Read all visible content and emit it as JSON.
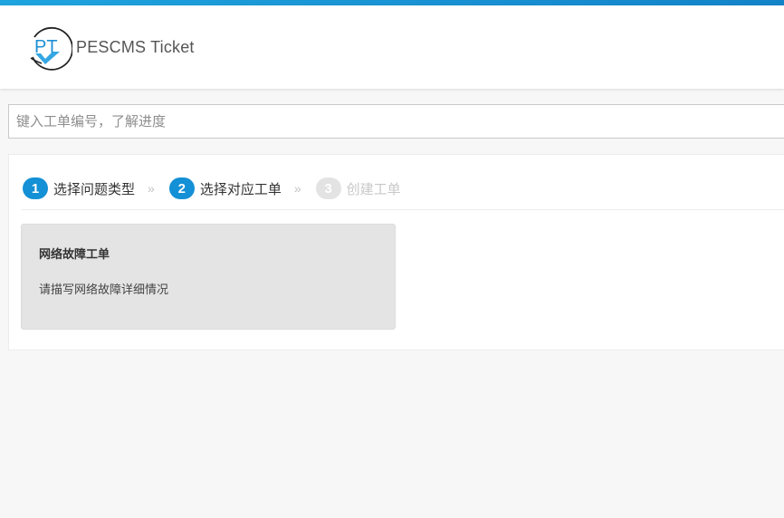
{
  "header": {
    "brand": "PESCMS Ticket",
    "logo_text": "PT",
    "colors": {
      "topbar": "#1383c8",
      "accent": "#1490d6"
    }
  },
  "search": {
    "placeholder": "键入工单编号，了解进度",
    "value": ""
  },
  "steps": [
    {
      "number": "1",
      "label": "选择问题类型",
      "state": "done"
    },
    {
      "number": "2",
      "label": "选择对应工单",
      "state": "current"
    },
    {
      "number": "3",
      "label": "创建工单",
      "state": "disabled"
    }
  ],
  "step_separator": "»",
  "tickets": [
    {
      "title": "网络故障工单",
      "description": "请描写网络故障详细情况"
    }
  ]
}
